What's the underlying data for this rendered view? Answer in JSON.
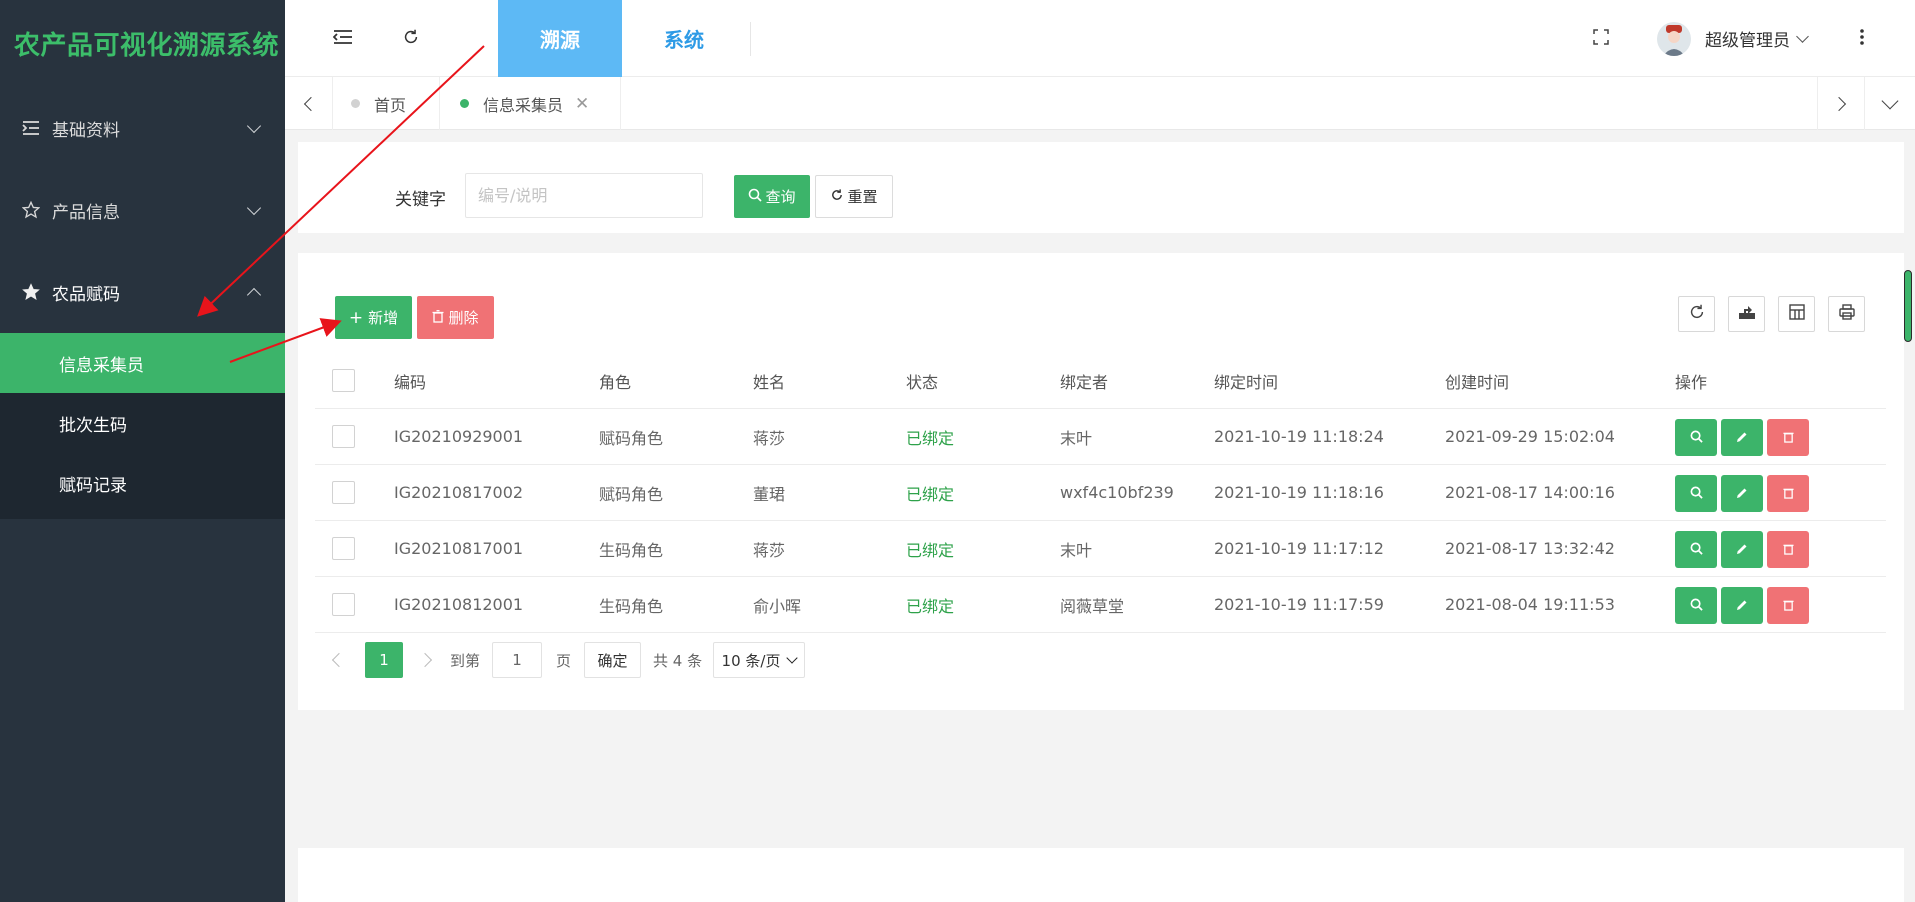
{
  "app": {
    "title": "农产品可视化溯源系统"
  },
  "sidebar": {
    "menus": [
      {
        "label": "基础资料",
        "icon": "list-indent-icon"
      },
      {
        "label": "产品信息",
        "icon": "star-outline-icon"
      },
      {
        "label": "农品赋码",
        "icon": "star-filled-icon"
      }
    ],
    "submenu": [
      {
        "label": "信息采集员"
      },
      {
        "label": "批次生码"
      },
      {
        "label": "赋码记录"
      }
    ]
  },
  "header": {
    "tabs": [
      {
        "label": "溯源"
      },
      {
        "label": "系统"
      }
    ],
    "user_name": "超级管理员"
  },
  "page_tabs": [
    {
      "label": "首页"
    },
    {
      "label": "信息采集员"
    }
  ],
  "search": {
    "keyword_label": "关键字",
    "keyword_placeholder": "编号/说明",
    "query_label": "查询",
    "reset_label": "重置"
  },
  "toolbar": {
    "add_label": "新增",
    "delete_label": "删除"
  },
  "table": {
    "columns": [
      "编码",
      "角色",
      "姓名",
      "状态",
      "绑定者",
      "绑定时间",
      "创建时间",
      "操作"
    ],
    "rows": [
      {
        "code": "IG20210929001",
        "role": "赋码角色",
        "name": "蒋莎",
        "status": "已绑定",
        "binder": "末叶",
        "bind_time": "2021-10-19 11:18:24",
        "create_time": "2021-09-29 15:02:04"
      },
      {
        "code": "IG20210817002",
        "role": "赋码角色",
        "name": "董珺",
        "status": "已绑定",
        "binder": "wxf4c10bf239",
        "bind_time": "2021-10-19 11:18:16",
        "create_time": "2021-08-17 14:00:16"
      },
      {
        "code": "IG20210817001",
        "role": "生码角色",
        "name": "蒋莎",
        "status": "已绑定",
        "binder": "末叶",
        "bind_time": "2021-10-19 11:17:12",
        "create_time": "2021-08-17 13:32:42"
      },
      {
        "code": "IG20210812001",
        "role": "生码角色",
        "name": "俞小晖",
        "status": "已绑定",
        "binder": "阅薇草堂",
        "bind_time": "2021-10-19 11:17:59",
        "create_time": "2021-08-04 19:11:53"
      }
    ]
  },
  "pager": {
    "current": "1",
    "goto_label": "到第",
    "goto_value": "1",
    "page_unit": "页",
    "confirm_label": "确定",
    "total_text": "共 4 条",
    "page_size": "10 条/页"
  },
  "colors": {
    "primary_green": "#3cb46a",
    "danger_red": "#f07275",
    "sidebar_bg": "#28333e",
    "header_active_tab": "#5db9f5",
    "annotation_arrow": "#e8141b"
  }
}
